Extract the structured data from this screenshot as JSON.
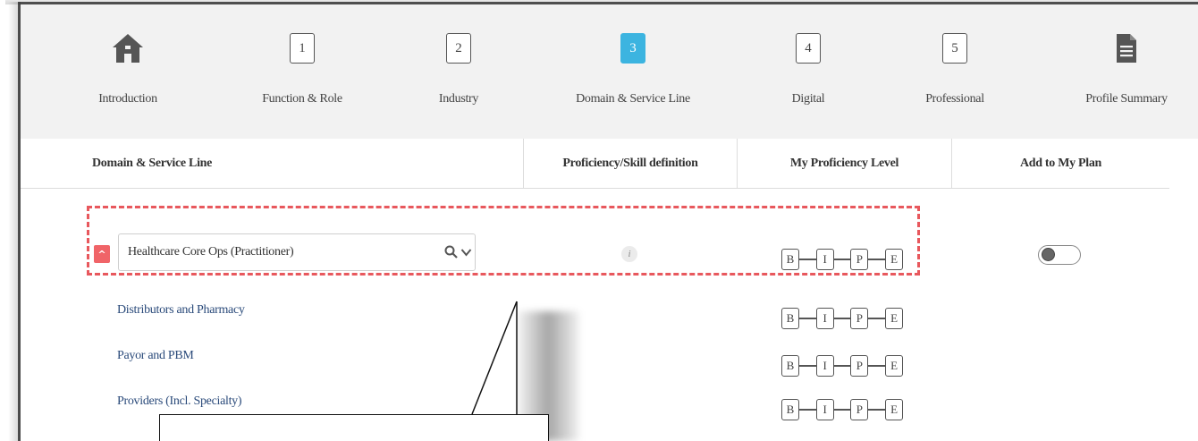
{
  "stepper": {
    "steps": [
      {
        "label": "Introduction",
        "icon": "home-icon"
      },
      {
        "label": "Function & Role",
        "number": "1"
      },
      {
        "label": "Industry",
        "number": "2"
      },
      {
        "label": "Domain & Service Line",
        "number": "3",
        "active": true
      },
      {
        "label": "Digital",
        "number": "4"
      },
      {
        "label": "Professional",
        "number": "5"
      },
      {
        "label": "Profile Summary",
        "icon": "document-icon"
      }
    ],
    "active_color": "#3cb4e0"
  },
  "table": {
    "headers": {
      "domain": "Domain & Service Line",
      "definition": "Proficiency/Skill definition",
      "level": "My Proficiency Level",
      "plan": "Add to My Plan"
    }
  },
  "domain_row": {
    "selected": "Healthcare Core Ops (Practitioner)",
    "info_glyph": "i",
    "levels": [
      "B",
      "I",
      "P",
      "E"
    ],
    "toggle_on": false,
    "highlight_color": "#e8585d"
  },
  "sub_items": [
    {
      "label": "Distributors and Pharmacy",
      "levels": [
        "B",
        "I",
        "P",
        "E"
      ]
    },
    {
      "label": "Payor and PBM",
      "levels": [
        "B",
        "I",
        "P",
        "E"
      ]
    },
    {
      "label": "Providers (Incl. Specialty)",
      "levels": [
        "B",
        "I",
        "P",
        "E"
      ]
    }
  ]
}
